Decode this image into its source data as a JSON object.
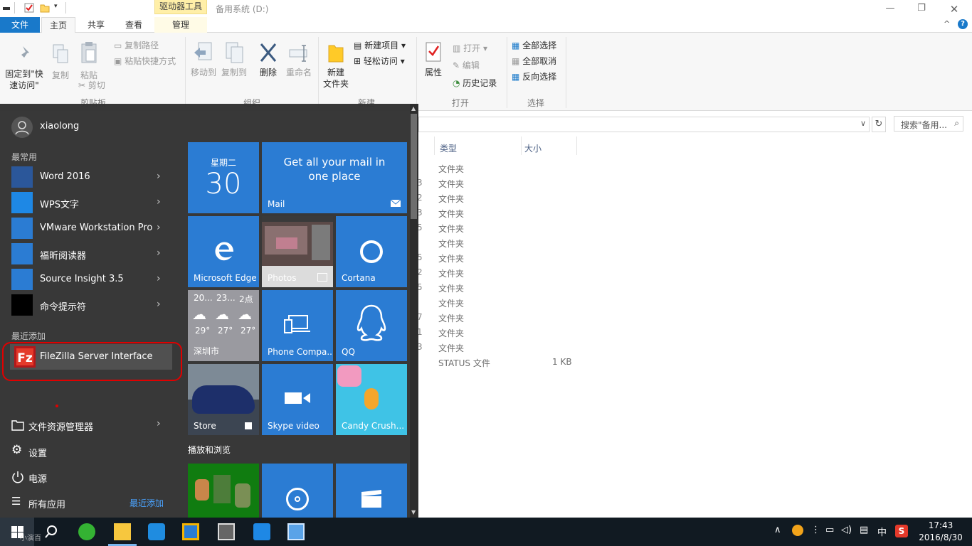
{
  "explorer": {
    "context_tab": "驱动器工具",
    "window_title": "备用系统 (D:)",
    "tabs": {
      "file": "文件",
      "home": "主页",
      "share": "共享",
      "view": "查看",
      "manage": "管理"
    },
    "ribbon": {
      "pin": "固定到\"快速访问\"",
      "copy": "复制",
      "paste": "粘贴",
      "copy_path": "复制路径",
      "paste_shortcut": "粘贴快捷方式",
      "cut": "剪切",
      "group_clipboard": "剪贴板",
      "move_to": "移动到",
      "copy_to": "复制到",
      "delete": "删除",
      "rename": "重命名",
      "group_organize": "组织",
      "new_folder": "新建\n文件夹",
      "new_item": "新建项目",
      "easy_access": "轻松访问",
      "group_new": "新建",
      "properties": "属性",
      "open": "打开",
      "edit": "编辑",
      "history": "历史记录",
      "group_open": "打开",
      "select_all": "全部选择",
      "select_none": "全部取消",
      "invert": "反向选择",
      "group_select": "选择"
    },
    "search_placeholder": "搜索\"备用...",
    "columns": {
      "type": "类型",
      "size": "大小"
    },
    "rows": [
      {
        "frag": "",
        "type": "文件夹",
        "size": ""
      },
      {
        "frag": "3",
        "type": "文件夹",
        "size": ""
      },
      {
        "frag": "2",
        "type": "文件夹",
        "size": ""
      },
      {
        "frag": "3",
        "type": "文件夹",
        "size": ""
      },
      {
        "frag": "5",
        "type": "文件夹",
        "size": ""
      },
      {
        "frag": "",
        "type": "文件夹",
        "size": ""
      },
      {
        "frag": "5",
        "type": "文件夹",
        "size": ""
      },
      {
        "frag": "2",
        "type": "文件夹",
        "size": ""
      },
      {
        "frag": "5",
        "type": "文件夹",
        "size": ""
      },
      {
        "frag": "",
        "type": "文件夹",
        "size": ""
      },
      {
        "frag": "7",
        "type": "文件夹",
        "size": ""
      },
      {
        "frag": "1",
        "type": "文件夹",
        "size": ""
      },
      {
        "frag": "3",
        "type": "文件夹",
        "size": ""
      },
      {
        "frag": "",
        "type": "STATUS 文件",
        "size": "1 KB"
      }
    ]
  },
  "start_menu": {
    "user": "xiaolong",
    "most_used_caption": "最常用",
    "most_used": [
      {
        "label": "Word 2016",
        "icon": "word-icon",
        "color": "#2b579a"
      },
      {
        "label": "WPS文字",
        "icon": "wps-icon",
        "color": "#1e88e5"
      },
      {
        "label": "VMware Workstation Pro",
        "icon": "vmware-icon",
        "color": "#2b7cd3"
      },
      {
        "label": "福昕阅读器",
        "icon": "foxit-icon",
        "color": "#2b7cd3"
      },
      {
        "label": "Source Insight 3.5",
        "icon": "source-insight-icon",
        "color": "#2b7cd3"
      },
      {
        "label": "命令提示符",
        "icon": "cmd-icon",
        "color": "#000000"
      }
    ],
    "recent_caption": "最近添加",
    "recent_app": "FileZilla Server Interface",
    "bottom": {
      "explorer": "文件资源管理器",
      "settings": "设置",
      "power": "电源",
      "all_apps": "所有应用",
      "recent_link": "最近添加"
    },
    "tiles": {
      "calendar_day": "星期二",
      "calendar_date": "30",
      "mail_text": "Get all your mail in one place",
      "mail_label": "Mail",
      "edge_label": "Microsoft Edge",
      "photos_label": "Photos",
      "cortana_label": "Cortana",
      "weather": [
        {
          "day": "20...",
          "temp": "29°"
        },
        {
          "day": "23...",
          "temp": "27°"
        },
        {
          "day": "2点",
          "temp": "27°"
        }
      ],
      "weather_city": "深圳市",
      "phone_label": "Phone Compa...",
      "qq_label": "QQ",
      "store_label": "Store",
      "skype_label": "Skype video",
      "candy_label": "Candy Crush...",
      "group2": "播放和浏览"
    }
  },
  "taskbar": {
    "search_hint": "小演百",
    "ime": "中",
    "time": "17:43",
    "date": "2016/8/30"
  }
}
